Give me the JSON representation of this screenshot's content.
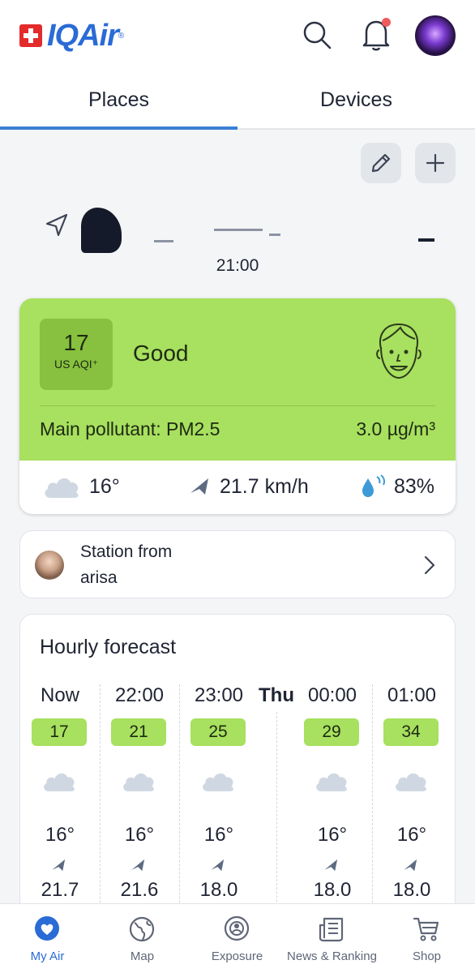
{
  "header": {
    "logo_text": "IQAir",
    "logo_tm": "®",
    "icons": [
      "search-icon",
      "bell-icon",
      "avatar"
    ],
    "accent": "#2a6bd6",
    "notification_dot_color": "#ef5a5a"
  },
  "tabs": [
    {
      "label": "Places",
      "active": true
    },
    {
      "label": "Devices",
      "active": false
    }
  ],
  "location": {
    "time": "21:00"
  },
  "aqi": {
    "value": "17",
    "unit": "US AQI⁺",
    "status": "Good",
    "main_pollutant_label": "Main pollutant: PM2.5",
    "concentration": "3.0 µg/m³",
    "status_color": "#a8e05f"
  },
  "weather": {
    "temperature": "16°",
    "wind": "21.7 km/h",
    "humidity": "83%"
  },
  "station": {
    "label": "Station from",
    "name": "arisa"
  },
  "forecast": {
    "title": "Hourly forecast",
    "day_label": "Thu",
    "hours": [
      {
        "time": "Now",
        "aqi": "17",
        "temp": "16°",
        "wind": "21.7"
      },
      {
        "time": "22:00",
        "aqi": "21",
        "temp": "16°",
        "wind": "21.6"
      },
      {
        "time": "23:00",
        "aqi": "25",
        "temp": "16°",
        "wind": "18.0"
      },
      {
        "time": "00:00",
        "aqi": "29",
        "temp": "16°",
        "wind": "18.0"
      },
      {
        "time": "01:00",
        "aqi": "34",
        "temp": "16°",
        "wind": "18.0"
      }
    ]
  },
  "bottom_nav": [
    {
      "label": "My Air",
      "icon": "heart-pin-icon",
      "active": true
    },
    {
      "label": "Map",
      "icon": "globe-icon",
      "active": false
    },
    {
      "label": "Exposure",
      "icon": "exposure-icon",
      "active": false
    },
    {
      "label": "News & Ranking",
      "icon": "news-icon",
      "active": false
    },
    {
      "label": "Shop",
      "icon": "cart-icon",
      "active": false
    }
  ]
}
